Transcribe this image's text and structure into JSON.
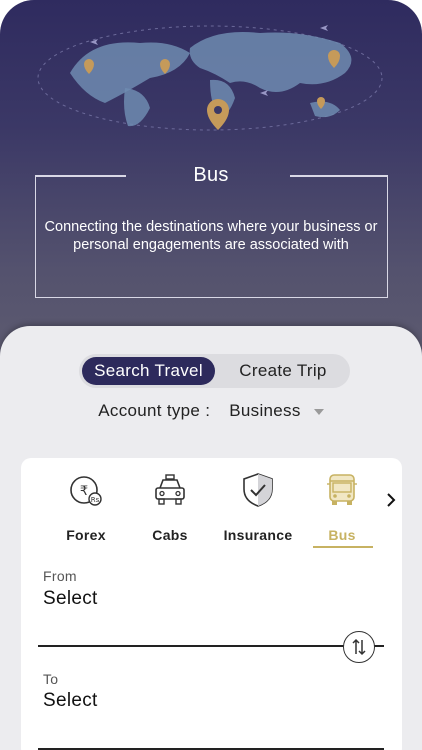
{
  "hero": {
    "title": "Bus",
    "description": "Connecting the destinations where your business or personal engagements are associated with"
  },
  "tabs": [
    {
      "label": "Search Travel",
      "active": true
    },
    {
      "label": "Create Trip",
      "active": false
    }
  ],
  "account": {
    "label": "Account type :",
    "value": "Business"
  },
  "services": [
    {
      "label": "Forex",
      "icon": "forex-icon",
      "active": false
    },
    {
      "label": "Cabs",
      "icon": "cab-icon",
      "active": false
    },
    {
      "label": "Insurance",
      "icon": "shield-check-icon",
      "active": false
    },
    {
      "label": "Bus",
      "icon": "bus-icon",
      "active": true
    }
  ],
  "form": {
    "from_label": "From",
    "from_value": "Select",
    "to_label": "To",
    "to_value": "Select"
  },
  "colors": {
    "primary": "#2d2a5c",
    "accent": "#c7b262",
    "pin": "#c59a5a"
  }
}
